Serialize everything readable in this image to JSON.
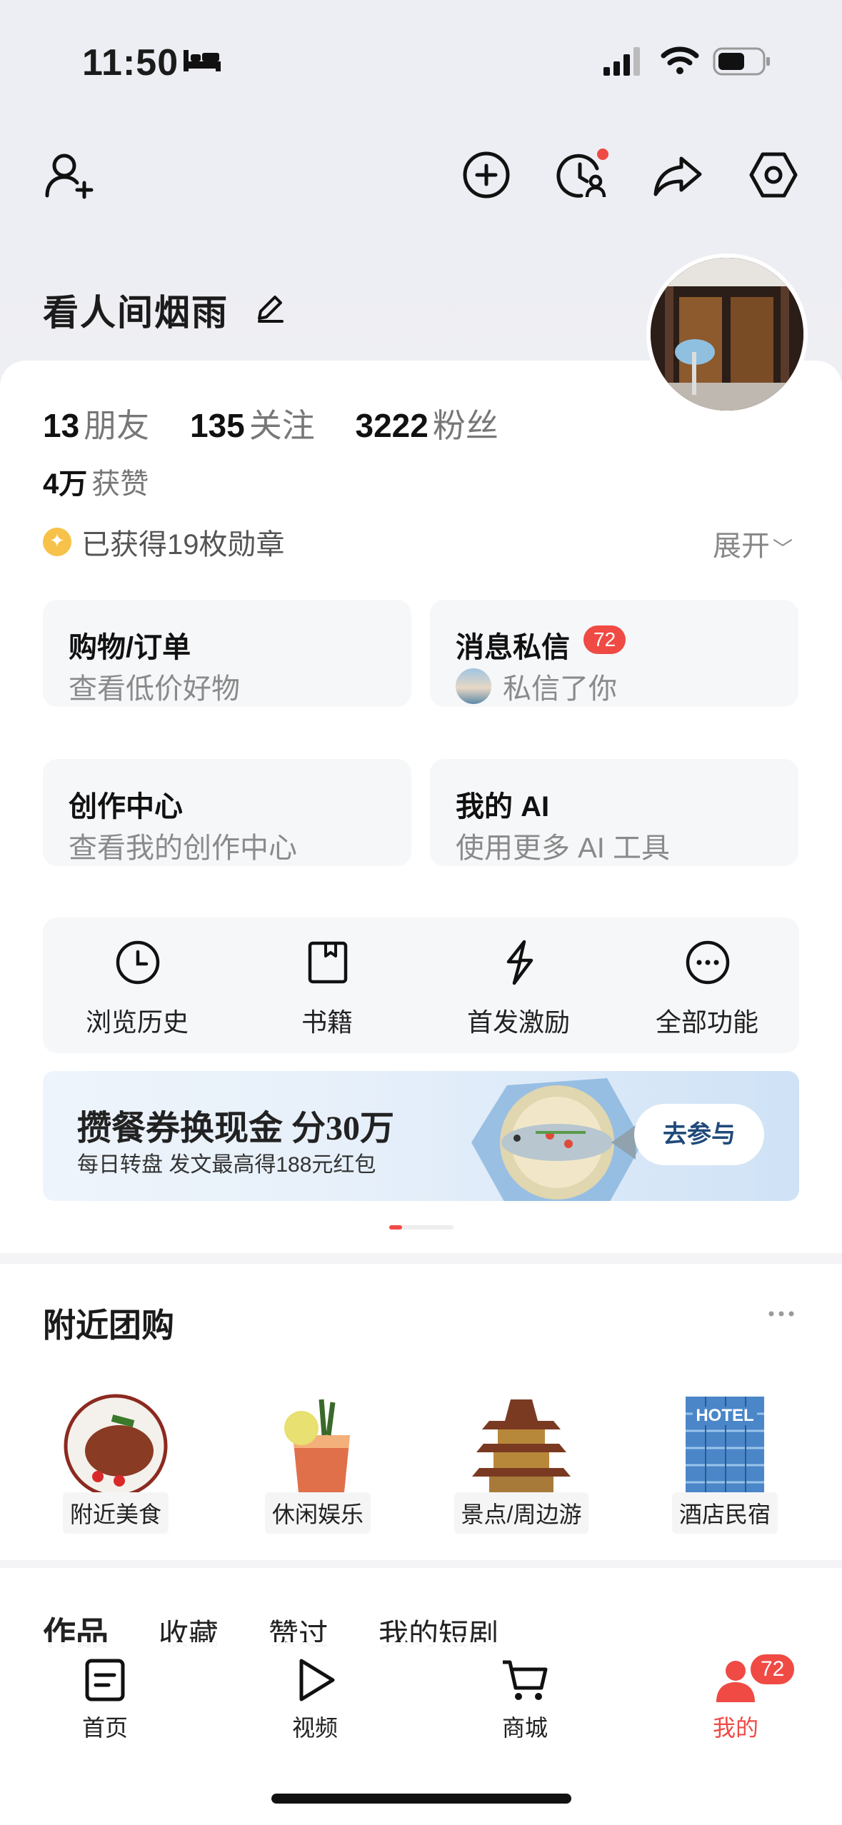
{
  "status_bar": {
    "time": "11:50"
  },
  "profile": {
    "nickname": "看人间烟雨",
    "stats": [
      {
        "num": "13",
        "label": "朋友"
      },
      {
        "num": "135",
        "label": "关注"
      },
      {
        "num": "3222",
        "label": "粉丝"
      }
    ],
    "likes_num": "4万",
    "likes_label": "获赞",
    "badges_text": "已获得19枚勋章",
    "expand_label": "展开"
  },
  "tiles": {
    "shopping": {
      "title": "购物/订单",
      "sub": "查看低价好物"
    },
    "messages": {
      "title": "消息私信",
      "count": "72",
      "sub": "私信了你"
    },
    "creator": {
      "title": "创作中心",
      "sub": "查看我的创作中心"
    },
    "ai": {
      "title": "我的 AI",
      "sub": "使用更多 AI 工具"
    }
  },
  "quick": [
    {
      "label": "浏览历史",
      "icon": "clock-icon"
    },
    {
      "label": "书籍",
      "icon": "bookmark-book-icon"
    },
    {
      "label": "首发激励",
      "icon": "lightning-icon"
    },
    {
      "label": "全部功能",
      "icon": "more-circle-icon"
    }
  ],
  "banner": {
    "title": "攒餐券换现金 分30万",
    "sub": "每日转盘 发文最高得188元红包",
    "button": "去参与"
  },
  "nearby": {
    "title": "附近团购",
    "items": [
      {
        "label": "附近美食"
      },
      {
        "label": "休闲娱乐"
      },
      {
        "label": "景点/周边游"
      },
      {
        "label": "酒店民宿"
      }
    ]
  },
  "tabs": [
    "作品",
    "收藏",
    "赞过",
    "我的短剧"
  ],
  "bottom_nav": [
    {
      "label": "首页",
      "icon": "home-doc-icon"
    },
    {
      "label": "视频",
      "icon": "play-icon"
    },
    {
      "label": "商城",
      "icon": "cart-icon"
    },
    {
      "label": "我的",
      "icon": "person-icon",
      "badge": "72"
    }
  ],
  "colors": {
    "accent": "#f04a44",
    "banner_button_text": "#1f4a7a"
  }
}
